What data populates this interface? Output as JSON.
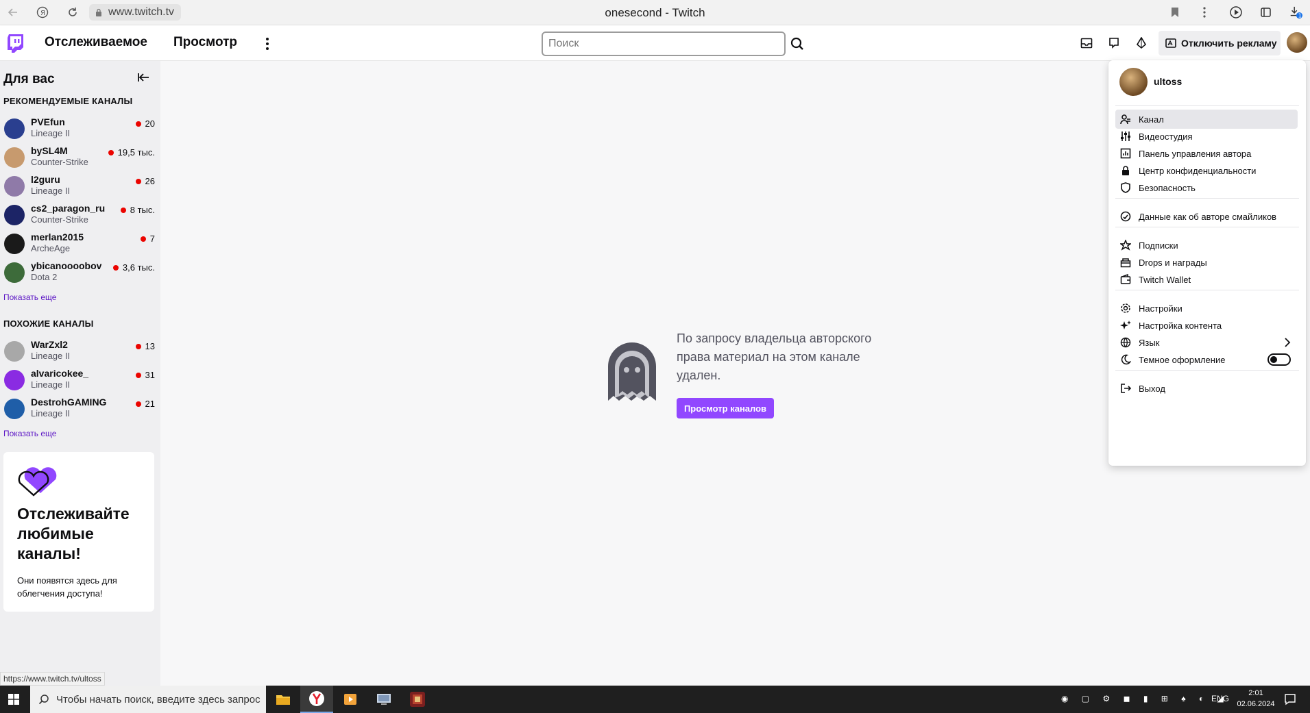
{
  "browser": {
    "url": "www.twitch.tv",
    "title": "onesecond - Twitch",
    "status_url": "https://www.twitch.tv/ultoss",
    "downloads_badge": "1"
  },
  "nav": {
    "following": "Отслеживаемое",
    "browse": "Просмотр",
    "search_placeholder": "Поиск",
    "adfree_label": "Отключить рекламу"
  },
  "sidebar": {
    "title": "Для вас",
    "recommended_header": "РЕКОМЕНДУЕМЫЕ КАНАЛЫ",
    "recommended": [
      {
        "name": "PVEfun",
        "game": "Lineage II",
        "viewers": "20",
        "color": "#2a3f8f"
      },
      {
        "name": "bySL4M",
        "game": "Counter-Strike",
        "viewers": "19,5 тыс.",
        "color": "#c79a6e"
      },
      {
        "name": "l2guru",
        "game": "Lineage II",
        "viewers": "26",
        "color": "#8f7aa8"
      },
      {
        "name": "cs2_paragon_ru",
        "game": "Counter-Strike",
        "viewers": "8 тыс.",
        "color": "#1c2466"
      },
      {
        "name": "merlan2015",
        "game": "ArcheAge",
        "viewers": "7",
        "color": "#1a1a1a"
      },
      {
        "name": "ybicanoooobov",
        "game": "Dota 2",
        "viewers": "3,6 тыс.",
        "color": "#3d6b3a"
      }
    ],
    "show_more_1": "Показать еще",
    "similar_header": "ПОХОЖИЕ КАНАЛЫ",
    "similar": [
      {
        "name": "WarZxl2",
        "game": "Lineage II",
        "viewers": "13",
        "color": "#a8a8a8"
      },
      {
        "name": "alvaricokee_",
        "game": "Lineage II",
        "viewers": "31",
        "color": "#8a2be2"
      },
      {
        "name": "DestrohGAMING",
        "game": "Lineage II",
        "viewers": "21",
        "color": "#1f5ea8"
      }
    ],
    "show_more_2": "Показать еще",
    "card_title": "Отслеживайте любимые каналы!",
    "card_text": "Они появятся здесь для облегчения доступа!"
  },
  "main": {
    "message": "По запросу владельца авторского права материал на этом канале удален.",
    "button": "Просмотр каналов"
  },
  "menu": {
    "username": "ultoss",
    "items": [
      {
        "label": "Канал",
        "icon": "person-icon"
      },
      {
        "label": "Видеостудия",
        "icon": "sliders-icon"
      },
      {
        "label": "Панель управления автора",
        "icon": "dashboard-icon"
      },
      {
        "label": "Центр конфиденциальности",
        "icon": "lock-icon"
      },
      {
        "label": "Безопасность",
        "icon": "shield-icon"
      },
      {
        "label": "Данные как об авторе смайликов",
        "icon": "emote-icon"
      },
      {
        "label": "Подписки",
        "icon": "star-icon"
      },
      {
        "label": "Drops и награды",
        "icon": "gift-icon"
      },
      {
        "label": "Twitch Wallet",
        "icon": "wallet-icon"
      },
      {
        "label": "Настройки",
        "icon": "gear-icon"
      },
      {
        "label": "Настройка контента",
        "icon": "sparkle-icon"
      },
      {
        "label": "Язык",
        "icon": "globe-icon"
      },
      {
        "label": "Темное оформление",
        "icon": "moon-icon"
      },
      {
        "label": "Выход",
        "icon": "logout-icon"
      }
    ]
  },
  "taskbar": {
    "search_placeholder": "Чтобы начать поиск, введите здесь запрос",
    "lang": "ENG",
    "time": "2:01",
    "date": "02.06.2024"
  },
  "colors": {
    "accent": "#9147ff",
    "live": "#eb0400"
  }
}
